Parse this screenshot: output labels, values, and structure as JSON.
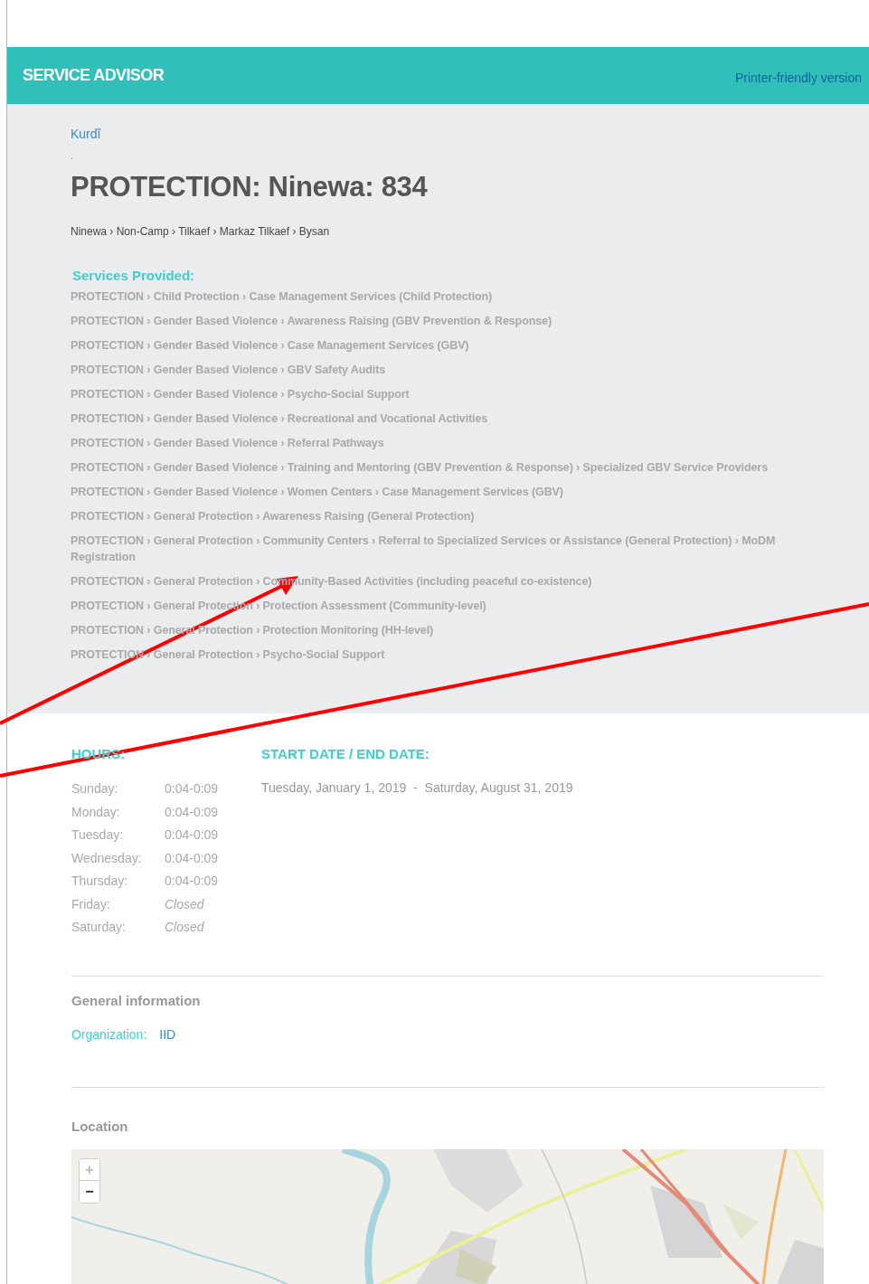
{
  "header": {
    "title": "SERVICE ADVISOR",
    "printer_link": "Printer-friendly version"
  },
  "language_link": "Kurdî",
  "dot": ".",
  "title": "PROTECTION: Ninewa: 834",
  "breadcrumb": {
    "separator": "›",
    "items": [
      "Ninewa",
      "Non-Camp",
      "Tilkaef",
      "Markaz Tilkaef",
      "Bysan"
    ]
  },
  "services": {
    "heading": "Services Provided:",
    "separator": "›",
    "items": [
      {
        "path": [
          "PROTECTION",
          "Child Protection",
          "Case Management Services (Child Protection)"
        ]
      },
      {
        "path": [
          "PROTECTION",
          "Gender Based Violence",
          "Awareness Raising (GBV Prevention & Response)"
        ]
      },
      {
        "path": [
          "PROTECTION",
          "Gender Based Violence",
          "Case Management Services (GBV)"
        ]
      },
      {
        "path": [
          "PROTECTION",
          "Gender Based Violence",
          "GBV Safety Audits"
        ]
      },
      {
        "path": [
          "PROTECTION",
          "Gender Based Violence",
          "Psycho-Social Support"
        ]
      },
      {
        "path": [
          "PROTECTION",
          "Gender Based Violence",
          "Recreational and Vocational Activities"
        ]
      },
      {
        "path": [
          "PROTECTION",
          "Gender Based Violence",
          "Referral Pathways"
        ]
      },
      {
        "path": [
          "PROTECTION",
          "Gender Based Violence",
          "Training and Mentoring (GBV Prevention & Response)",
          "Specialized GBV Service Providers"
        ]
      },
      {
        "path": [
          "PROTECTION",
          "Gender Based Violence",
          "Women Centers",
          "Case Management Services (GBV)"
        ]
      },
      {
        "path": [
          "PROTECTION",
          "General Protection",
          "Awareness Raising (General Protection)"
        ]
      },
      {
        "path": [
          "PROTECTION",
          "General Protection",
          "Community Centers",
          "Referral to Specialized Services or Assistance (General Protection)",
          "MoDM Registration"
        ]
      },
      {
        "path": [
          "PROTECTION",
          "General Protection",
          "Community-Based Activities (including peaceful co-existence)"
        ]
      },
      {
        "path": [
          "PROTECTION",
          "General Protection",
          "Protection Assessment (Community-level)"
        ]
      },
      {
        "path": [
          "PROTECTION",
          "General Protection",
          "Protection Monitoring (HH-level)"
        ]
      },
      {
        "path": [
          "PROTECTION",
          "General Protection",
          "Psycho-Social Support"
        ]
      }
    ]
  },
  "hours": {
    "heading": "HOURS:",
    "rows": [
      {
        "day": "Sunday:",
        "time": "0:04-0:09",
        "closed": false
      },
      {
        "day": "Monday:",
        "time": "0:04-0:09",
        "closed": false
      },
      {
        "day": "Tuesday:",
        "time": "0:04-0:09",
        "closed": false
      },
      {
        "day": "Wednesday:",
        "time": "0:04-0:09",
        "closed": false
      },
      {
        "day": "Thursday:",
        "time": "0:04-0:09",
        "closed": false
      },
      {
        "day": "Friday:",
        "time": "Closed",
        "closed": true
      },
      {
        "day": "Saturday:",
        "time": "Closed",
        "closed": true
      }
    ]
  },
  "dates": {
    "heading": "START DATE / END DATE:",
    "range": "Tuesday, January 1, 2019  -  Saturday, August 31, 2019"
  },
  "general": {
    "heading": "General information",
    "organization_label": "Organization:",
    "organization": "IID"
  },
  "location": {
    "heading": "Location",
    "zoom_in": "+",
    "zoom_out": "−"
  }
}
